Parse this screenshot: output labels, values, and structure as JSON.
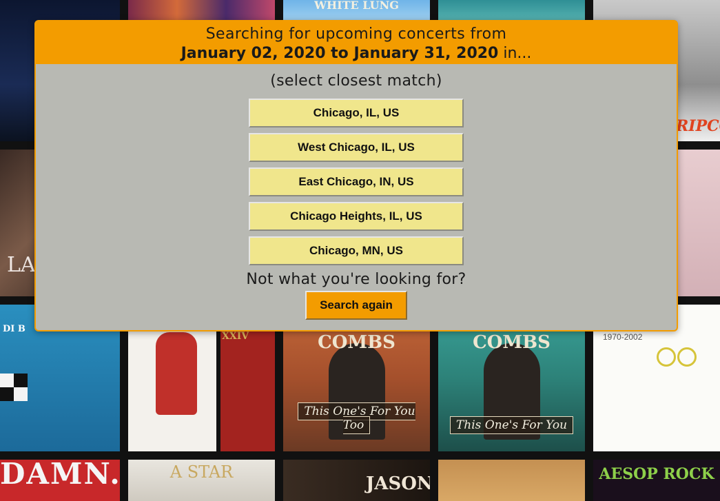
{
  "background_albums": {
    "row1": [
      {
        "name": "album-tile-halsey-badlands",
        "text": "",
        "sub": ""
      },
      {
        "name": "album-tile-colorful",
        "text": "",
        "sub": ""
      },
      {
        "name": "album-tile-white-lung",
        "text": "WHITE LUNG",
        "sub": ""
      },
      {
        "name": "album-tile-teal",
        "text": "",
        "sub": ""
      },
      {
        "name": "album-tile-keith-urban-ripcord",
        "text": "RIPCOR",
        "sub": ""
      }
    ],
    "row2": [
      {
        "name": "album-tile-portrait-left",
        "text": "LA",
        "sub": ""
      },
      {
        "name": "album-tile-pink-right",
        "text": "",
        "sub": ""
      }
    ],
    "row3": [
      {
        "name": "album-tile-cardi-b",
        "text": "DI B",
        "sub": ""
      },
      {
        "name": "album-tile-bruno-mars-24k",
        "text": "XXIV",
        "sub": ""
      },
      {
        "name": "album-tile-luke-combs-too",
        "text": "COMBS",
        "sub": "This One's For You Too"
      },
      {
        "name": "album-tile-luke-combs",
        "text": "COMBS",
        "sub": "This One's For You"
      },
      {
        "name": "album-tile-elton-john",
        "text": "1970-2002",
        "sub": ""
      }
    ],
    "row4": [
      {
        "name": "album-tile-damn",
        "text": "DAMN.",
        "sub": ""
      },
      {
        "name": "album-tile-a-star",
        "text": "A STAR",
        "sub": ""
      },
      {
        "name": "album-tile-jason",
        "text": "JASON",
        "sub": ""
      },
      {
        "name": "album-tile-cowboy",
        "text": "",
        "sub": ""
      },
      {
        "name": "album-tile-aesop-rock",
        "text": "AESOP ROCK",
        "sub": ""
      }
    ]
  },
  "modal": {
    "header_line1": "Searching for upcoming concerts from",
    "date_range": "January 02, 2020 to January 31, 2020",
    "header_suffix": " in...",
    "prompt": "(select closest match)",
    "options": [
      "Chicago, IL, US",
      "West Chicago, IL, US",
      "East Chicago, IN, US",
      "Chicago Heights, IL, US",
      "Chicago, MN, US"
    ],
    "not_found_text": "Not what you're looking for?",
    "search_again_label": "Search again"
  },
  "colors": {
    "accent": "#f39c00",
    "modal_bg": "#b8b9b3",
    "option_bg": "#f0e68c"
  }
}
